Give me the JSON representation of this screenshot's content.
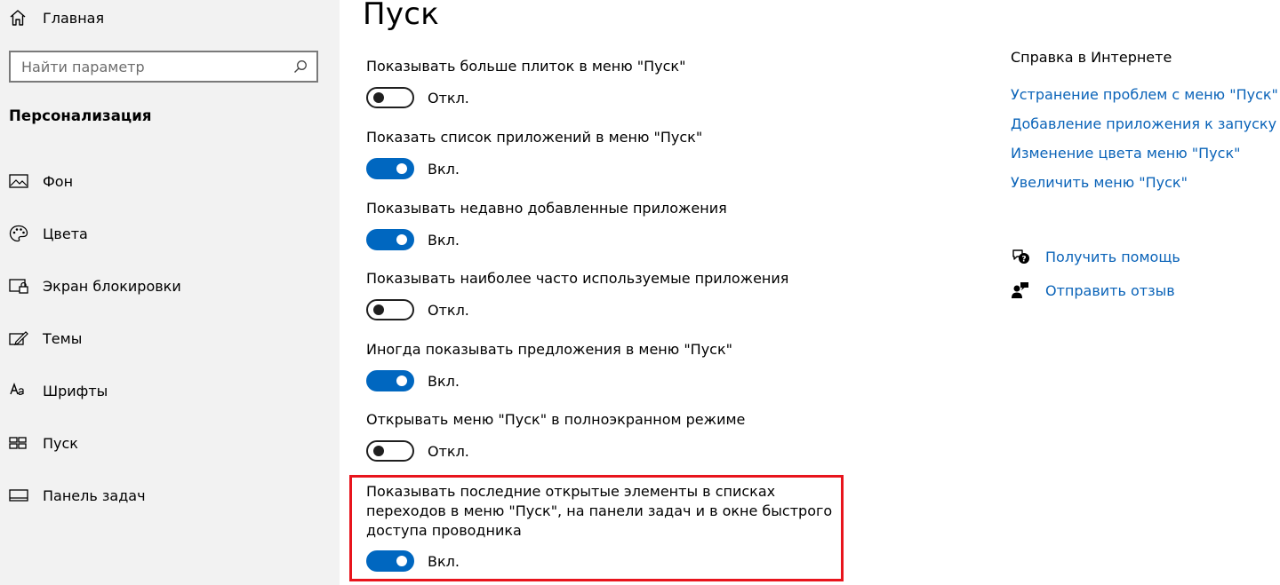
{
  "sidebar": {
    "home_label": "Главная",
    "search": {
      "placeholder": "Найти параметр",
      "value": ""
    },
    "section_title": "Персонализация",
    "items": [
      {
        "label": "Фон",
        "icon": "picture-icon"
      },
      {
        "label": "Цвета",
        "icon": "palette-icon"
      },
      {
        "label": "Экран блокировки",
        "icon": "lock-screen-icon"
      },
      {
        "label": "Темы",
        "icon": "themes-icon"
      },
      {
        "label": "Шрифты",
        "icon": "fonts-icon"
      },
      {
        "label": "Пуск",
        "icon": "start-icon"
      },
      {
        "label": "Панель задач",
        "icon": "taskbar-icon"
      }
    ]
  },
  "main": {
    "title": "Пуск",
    "settings": [
      {
        "label": "Показывать больше плиток в меню \"Пуск\"",
        "state": "off",
        "state_label": "Откл."
      },
      {
        "label": "Показать список приложений в меню \"Пуск\"",
        "state": "on",
        "state_label": "Вкл."
      },
      {
        "label": "Показывать недавно добавленные приложения",
        "state": "on",
        "state_label": "Вкл."
      },
      {
        "label": "Показывать наиболее часто используемые приложения",
        "state": "off",
        "state_label": "Откл."
      },
      {
        "label": "Иногда показывать предложения в меню \"Пуск\"",
        "state": "on",
        "state_label": "Вкл."
      },
      {
        "label": "Открывать меню \"Пуск\" в полноэкранном режиме",
        "state": "off",
        "state_label": "Откл."
      },
      {
        "label": "Показывать последние открытые элементы в списках переходов в меню \"Пуск\", на панели задач и в окне быстрого доступа проводника",
        "state": "on",
        "state_label": "Вкл."
      }
    ]
  },
  "help": {
    "title": "Справка в Интернете",
    "links": [
      "Устранение проблем с меню \"Пуск\"",
      "Добавление приложения к запуску",
      "Изменение цвета меню \"Пуск\"",
      "Увеличить меню \"Пуск\""
    ],
    "get_help": "Получить помощь",
    "feedback": "Отправить отзыв"
  },
  "colors": {
    "accent": "#0067c0",
    "link": "#0a63b8",
    "highlight": "#e8141c",
    "sidebar_bg": "#f2f2f2"
  }
}
